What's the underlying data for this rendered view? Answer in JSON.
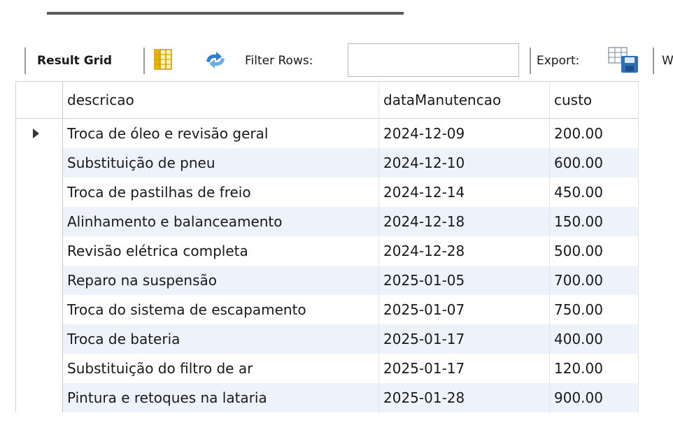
{
  "toolbar": {
    "result_grid_label": "Result Grid",
    "filter_label": "Filter Rows:",
    "filter_value": "",
    "export_label": "Export:",
    "wrap_label": "W"
  },
  "grid": {
    "columns": [
      "descricao",
      "dataManutencao",
      "custo"
    ],
    "rows": [
      [
        "Troca de óleo e revisão geral",
        "2024-12-09",
        "200.00"
      ],
      [
        "Substituição de pneu",
        "2024-12-10",
        "600.00"
      ],
      [
        "Troca de pastilhas de freio",
        "2024-12-14",
        "450.00"
      ],
      [
        "Alinhamento e balanceamento",
        "2024-12-18",
        "150.00"
      ],
      [
        "Revisão elétrica completa",
        "2024-12-28",
        "500.00"
      ],
      [
        "Reparo na suspensão",
        "2025-01-05",
        "700.00"
      ],
      [
        "Troca do sistema de escapamento",
        "2025-01-07",
        "750.00"
      ],
      [
        "Troca de bateria",
        "2025-01-17",
        "400.00"
      ],
      [
        "Substituição do filtro de ar",
        "2025-01-17",
        "120.00"
      ],
      [
        "Pintura e retoques na lataria",
        "2025-01-28",
        "900.00"
      ]
    ]
  },
  "colors": {
    "row_alt": "#eef3fb",
    "row_base": "#ffffff",
    "icon_blue": "#2f7fd3",
    "icon_yellow": "#e8b400"
  }
}
